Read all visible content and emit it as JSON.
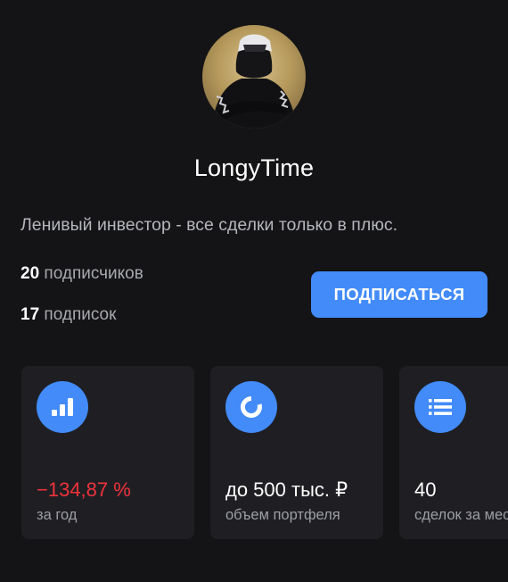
{
  "profile": {
    "username": "LongyTime",
    "bio": "Ленивый инвестор - все сделки только в плюс.",
    "followers": {
      "count": "20",
      "label": "подписчиков"
    },
    "following": {
      "count": "17",
      "label": "подписок"
    },
    "subscribe_label": "ПОДПИСАТЬСЯ"
  },
  "cards": [
    {
      "icon": "bar-chart-icon",
      "value": "−134,87 %",
      "caption": "за год",
      "value_color": "#f0323c"
    },
    {
      "icon": "donut-chart-icon",
      "value": "до 500 тыс. ₽",
      "caption": "объем портфеля"
    },
    {
      "icon": "list-icon",
      "value": "40",
      "caption": "сделок за месяц"
    }
  ],
  "colors": {
    "background": "#141416",
    "card": "#1f1f23",
    "accent": "#428bf9",
    "negative": "#f0323c"
  }
}
